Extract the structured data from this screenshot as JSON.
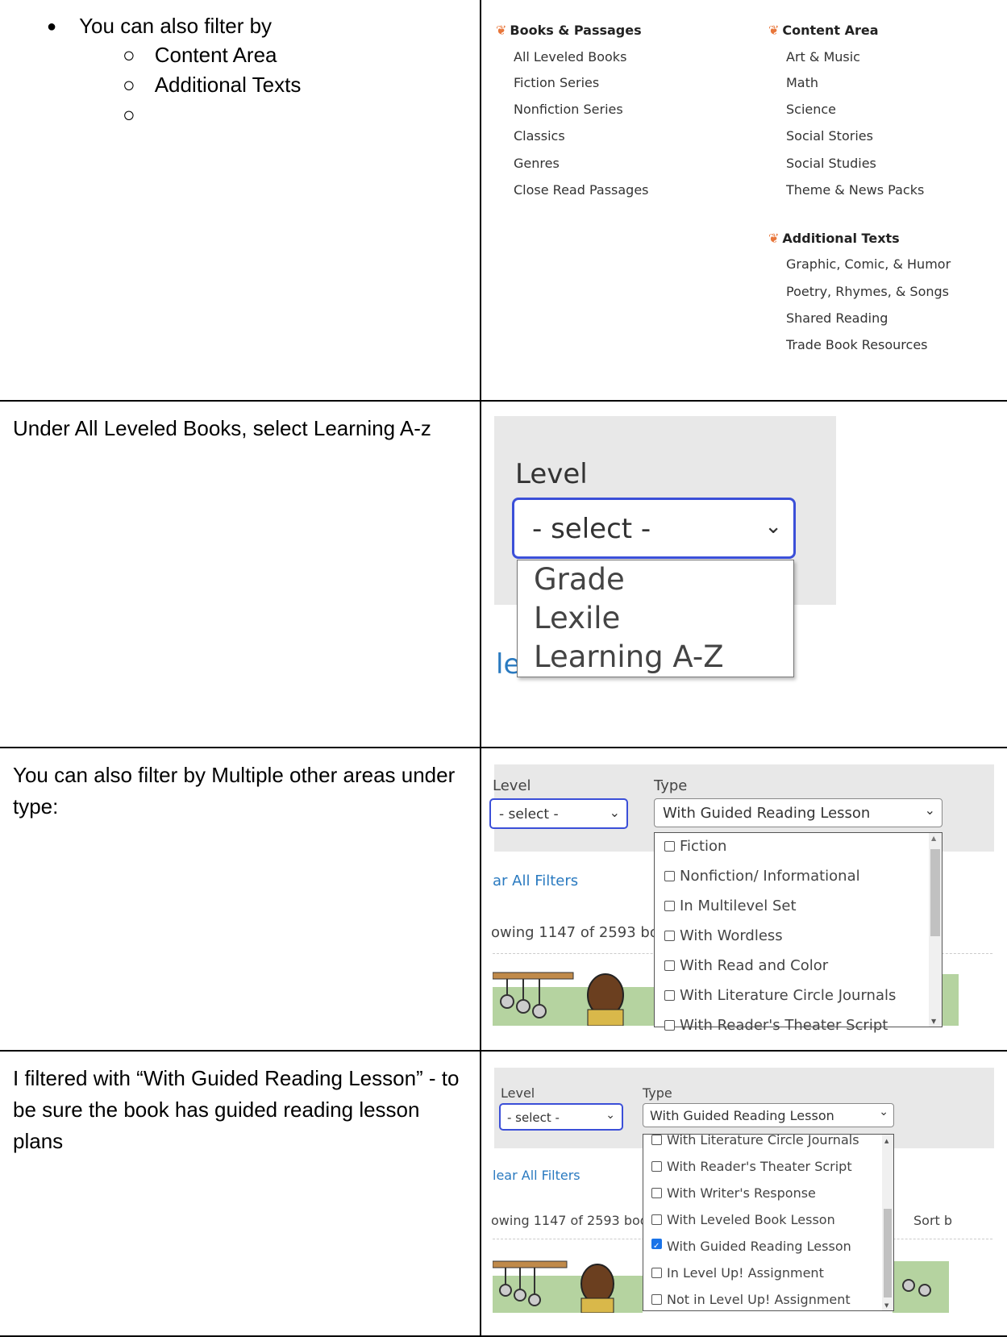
{
  "row1": {
    "bullet": "You can also filter by",
    "sub_items": [
      "Content Area",
      "Additional Texts",
      ""
    ],
    "menu": {
      "books": {
        "heading": "Books & Passages",
        "items": [
          "All Leveled Books",
          "Fiction Series",
          "Nonfiction Series",
          "Classics",
          "Genres",
          "Close Read Passages"
        ]
      },
      "content": {
        "heading": "Content Area",
        "items": [
          "Art & Music",
          "Math",
          "Science",
          "Social Stories",
          "Social Studies",
          "Theme & News Packs"
        ]
      },
      "additional": {
        "heading": "Additional Texts",
        "items": [
          "Graphic, Comic, & Humor",
          "Poetry, Rhymes, & Songs",
          "Shared Reading",
          "Trade Book Resources"
        ]
      }
    }
  },
  "row2": {
    "text": "Under All Leveled Books, select Learning A-z",
    "level_label": "Level",
    "select_value": "- select -",
    "options": [
      "Grade",
      "Lexile",
      "Learning A-Z"
    ],
    "partial_link": "le"
  },
  "row3": {
    "text": "You can also filter by Multiple other areas under type:",
    "level_label": "Level",
    "type_label": "Type",
    "level_value": "- select -",
    "type_value": "With Guided Reading Lesson",
    "clear_link": "ar All Filters",
    "showing": "owing 1147 of 2593 boo",
    "options": [
      "Fiction",
      "Nonfiction/ Informational",
      "In Multilevel Set",
      "With Wordless",
      "With Read and Color",
      "With Literature Circle Journals",
      "With Reader's Theater Script"
    ]
  },
  "row4": {
    "text": "I filtered with “With Guided Reading Lesson” - to be sure the book has guided reading lesson plans",
    "level_label": "Level",
    "type_label": "Type",
    "level_value": "- select -",
    "type_value": "With Guided Reading Lesson",
    "clear_link": "lear All Filters",
    "showing": "owing 1147 of 2593 boo",
    "sort": "Sort b",
    "options": [
      {
        "label": "With Literature Circle Journals",
        "checked": false
      },
      {
        "label": "With Reader's Theater Script",
        "checked": false
      },
      {
        "label": "With Writer's Response",
        "checked": false
      },
      {
        "label": "With Leveled Book Lesson",
        "checked": false
      },
      {
        "label": "With Guided Reading Lesson",
        "checked": true
      },
      {
        "label": "In Level Up! Assignment",
        "checked": false
      },
      {
        "label": "Not in Level Up! Assignment",
        "checked": false
      }
    ]
  }
}
